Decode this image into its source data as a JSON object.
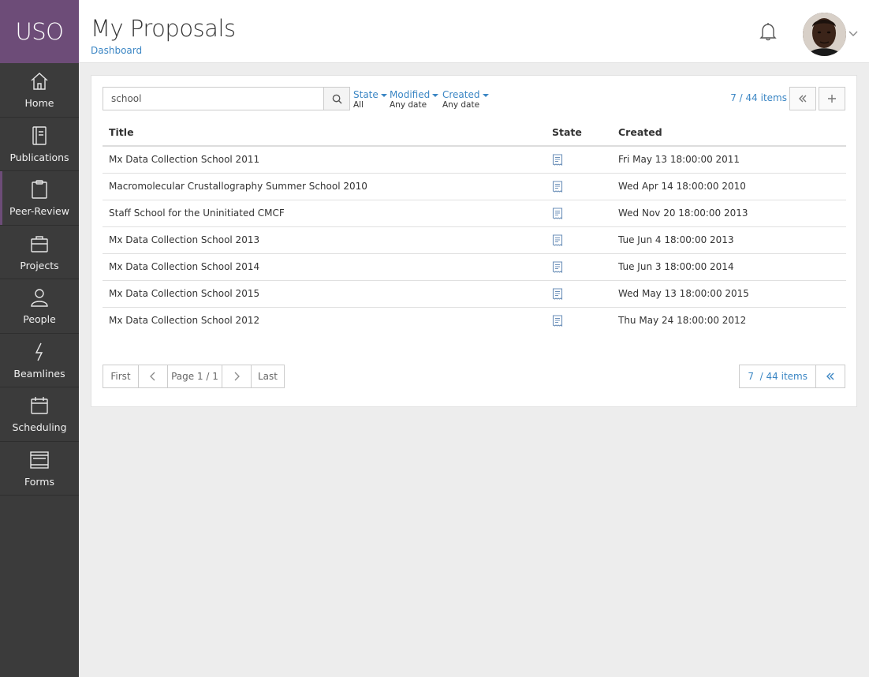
{
  "brand": {
    "name": "USO"
  },
  "sidebar": {
    "items": [
      {
        "label": "Home",
        "icon": "home-icon"
      },
      {
        "label": "Publications",
        "icon": "book-icon"
      },
      {
        "label": "Peer-Review",
        "icon": "clipboard-icon"
      },
      {
        "label": "Projects",
        "icon": "briefcase-icon"
      },
      {
        "label": "People",
        "icon": "person-icon"
      },
      {
        "label": "Beamlines",
        "icon": "lightning-icon"
      },
      {
        "label": "Scheduling",
        "icon": "calendar-icon"
      },
      {
        "label": "Forms",
        "icon": "forms-icon"
      }
    ],
    "active_item": "Peer-Review"
  },
  "header": {
    "title": "My Proposals",
    "breadcrumb": "Dashboard"
  },
  "toolbar": {
    "search_value": "school",
    "filters": [
      {
        "label": "State",
        "value": "All"
      },
      {
        "label": "Modified",
        "value": "Any date"
      },
      {
        "label": "Created",
        "value": "Any date"
      }
    ],
    "count_text": "7 / 44 items"
  },
  "table": {
    "columns": [
      "Title",
      "State",
      "Created"
    ],
    "rows": [
      {
        "title": "Mx Data Collection School 2011",
        "state_icon": "document-icon",
        "created": "Fri May 13 18:00:00 2011"
      },
      {
        "title": "Macromolecular Crustallography Summer School 2010",
        "state_icon": "document-icon",
        "created": "Wed Apr 14 18:00:00 2010"
      },
      {
        "title": "Staff School for the Uninitiated CMCF",
        "state_icon": "document-icon",
        "created": "Wed Nov 20 18:00:00 2013"
      },
      {
        "title": "Mx Data Collection School 2013",
        "state_icon": "document-icon",
        "created": "Tue Jun 4 18:00:00 2013"
      },
      {
        "title": "Mx Data Collection School 2014",
        "state_icon": "document-icon",
        "created": "Tue Jun 3 18:00:00 2014"
      },
      {
        "title": "Mx Data Collection School 2015",
        "state_icon": "document-icon",
        "created": "Wed May 13 18:00:00 2015"
      },
      {
        "title": "Mx Data Collection School 2012",
        "state_icon": "document-icon",
        "created": "Thu May 24 18:00:00 2012"
      }
    ]
  },
  "pagination": {
    "first": "First",
    "page": "Page 1 / 1",
    "last": "Last",
    "count_text": "7  / 44 items"
  },
  "colors": {
    "brand": "#6d4c78",
    "sidebar": "#3b3b3b",
    "link": "#3b86c4"
  }
}
